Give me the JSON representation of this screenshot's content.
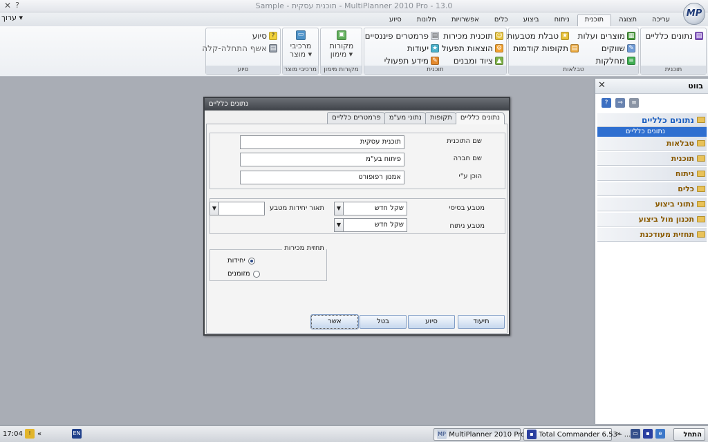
{
  "window": {
    "title": "Sample - תוכנית עסקית - MultiPlanner 2010 Pro - 13.0",
    "logo_text": "MP",
    "edit_menu": "ערוך"
  },
  "ribbon_tabs": [
    "עריכה",
    "תצוגה",
    "תוכנית",
    "ניתוח",
    "ביצוע",
    "כלים",
    "אפשרויות",
    "חלונות",
    "סיוע"
  ],
  "active_tab": "תוכנית",
  "ribbon": {
    "plan_group": {
      "label": "תוכנית",
      "general_data": "נתונים כלליים"
    },
    "tables_group": {
      "label": "טבלאות",
      "products": "מוצרים ועלות",
      "currency_table": "טבלת מטבעות",
      "markets": "שווקים",
      "prev_periods": "תקופות קודמות",
      "departments": "מחלקות"
    },
    "plan2_group": {
      "label": "תוכנית",
      "sales_plan": "תוכנית מכירות",
      "financial_params": "פרמטרים פיננסיים",
      "operating_expenses": "הוצאות תפעול",
      "targets": "יעודות",
      "equipment": "ציוד ומבנים",
      "operating_info": "מידע תפעולי"
    },
    "funding_group": {
      "label": "מקורות מימון",
      "button": "מקורות מימון"
    },
    "product_group": {
      "label": "מרכיבי מוצר",
      "button": "מרכיבי מוצר"
    },
    "help_group": {
      "label": "סיוע",
      "help": "סיוע",
      "wizard": "אשף התחלה-קלה"
    }
  },
  "panel": {
    "title": "בווט",
    "items": [
      "נתונים כלליים",
      "טבלאות",
      "תוכנית",
      "ניתוח",
      "כלים",
      "נתוני ביצוע",
      "תכנון מול ביצוע",
      "תחזית מעודכנת"
    ],
    "selected_sub": "נתונים כלליים"
  },
  "dialog": {
    "title": "נתונים כלליים",
    "tabs": [
      "נתונים כלליים",
      "תקופות",
      "נתוני מע\"מ",
      "פרמטרים כלליים"
    ],
    "plan_name_label": "שם התוכנית",
    "plan_name": "תוכנית עסקית",
    "company_label": "שם חברה",
    "company": "פיתוח בע\"מ",
    "prepared_label": "הוכן ע\"י",
    "prepared": "אמנון רפופורט",
    "base_currency_label": "מטבע בסיסי",
    "base_currency": "שקל חדש",
    "currency_unit_label": "תאור יחידות מטבע",
    "currency_unit": "",
    "analysis_currency_label": "מטבע ניתוח",
    "analysis_currency": "שקל חדש",
    "forecast_legend": "תחזית מכירות",
    "radio_units": "יחידות",
    "radio_cash": "מזומנים",
    "buttons": {
      "doc": "תיעוד",
      "help": "סיוע",
      "cancel": "בטל",
      "ok": "אשר"
    }
  },
  "taskbar": {
    "start": "התחל",
    "task1": "Total Commander 6.53 - ...",
    "task2": "MultiPlanner 2010 Pro - 1...",
    "lang": "EN",
    "clock": "17:04"
  }
}
